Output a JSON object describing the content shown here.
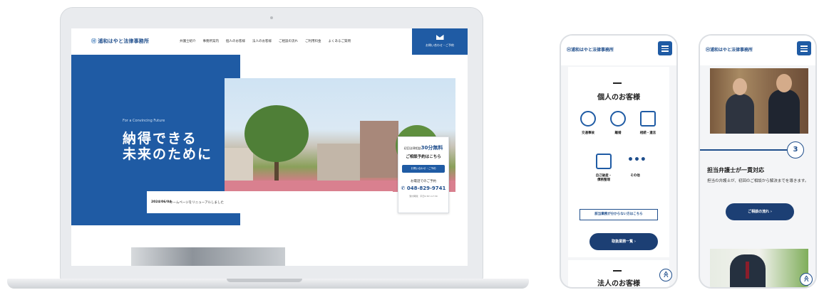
{
  "desktop": {
    "logo": "浦和はやと法律事務所",
    "nav": [
      "弁護士紹介",
      "事務所案内",
      "個人のお客様",
      "法人のお客様",
      "ご相談の流れ",
      "ご利用料金",
      "よくあるご質問"
    ],
    "contact_button": "お問い合わせ・ご予約",
    "tagline_en": "For a Convincing Future",
    "headline_line1": "納得できる",
    "headline_line2": "未来のために",
    "consult_free_prefix": "初回法律相談",
    "consult_free": "30分無料",
    "consult_reserve": "ご相談予約はこちら",
    "web_button": "お問い合わせ・ご予約",
    "phone_label": "お電話でのご予約",
    "phone_number": "048-829-9741",
    "hours": "受付時間：平日9:30〜17:30",
    "news_date": "2024/06/04",
    "news_text": "ホームページをリニューアルしました"
  },
  "phone1": {
    "logo": "浦和はやと法律事務所",
    "section_title": "個人のお客様",
    "services": [
      {
        "label": "交通事故",
        "icon": "car-icon"
      },
      {
        "label": "離婚",
        "icon": "heart-icon"
      },
      {
        "label": "相続・遺言",
        "icon": "document-icon"
      },
      {
        "label_line1": "自己破産・",
        "label_line2": "債務整理",
        "icon": "debt-icon"
      },
      {
        "label": "その他",
        "icon": "more-icon"
      }
    ],
    "unknown_link": "該当業務が分からない方はこちら",
    "practice_button": "取扱業務一覧",
    "section_title2": "法人のお客様",
    "back_to_top": "≪"
  },
  "phone2": {
    "logo": "浦和はやと法律事務所",
    "step_number": "3",
    "title": "担当弁護士が一貫対応",
    "body": "担当の弁護士が、初回のご相談から解決までを導きます。",
    "flow_button": "ご相談の流れ",
    "back_to_top": "≪"
  },
  "colors": {
    "primary": "#1f5ba4",
    "dark_navy": "#1c3f74",
    "text": "#222222"
  }
}
